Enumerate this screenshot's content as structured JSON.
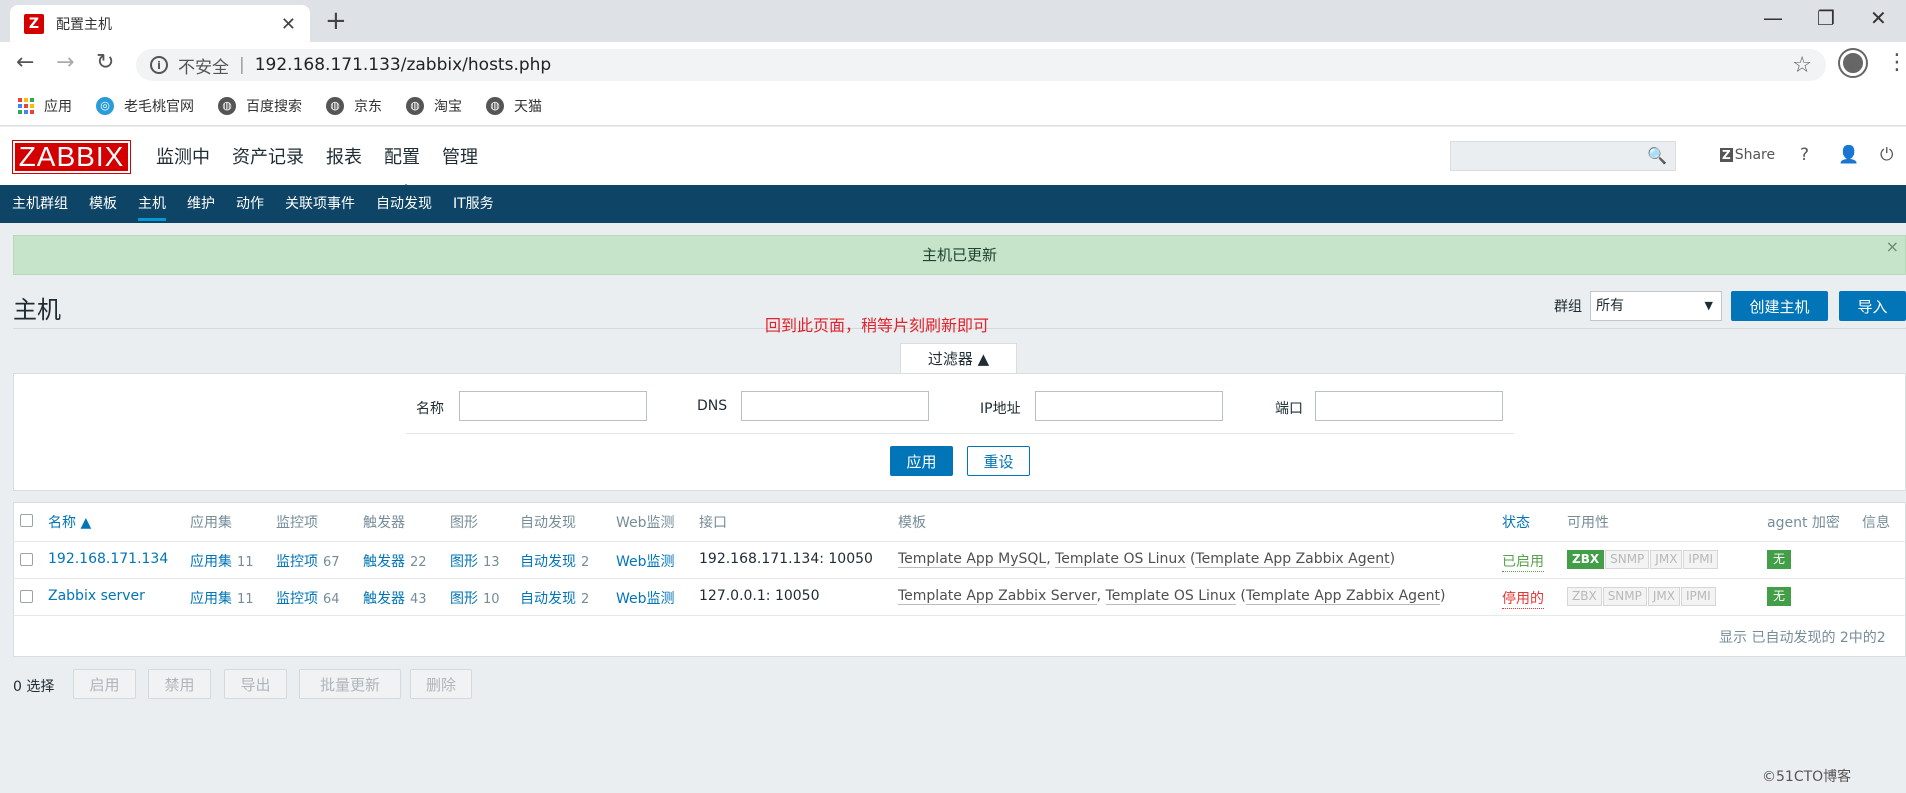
{
  "browser": {
    "tab_title": "配置主机",
    "security": "不安全",
    "url": "192.168.171.133/zabbix/hosts.php",
    "bookmarks": [
      "应用",
      "老毛桃官网",
      "百度搜索",
      "京东",
      "淘宝",
      "天猫"
    ]
  },
  "header": {
    "logo": "ZABBIX",
    "menu": [
      "监测中",
      "资产记录",
      "报表",
      "配置",
      "管理"
    ],
    "share": "Share",
    "help": "?"
  },
  "subnav": [
    "主机群组",
    "模板",
    "主机",
    "维护",
    "动作",
    "关联项事件",
    "自动发现",
    "IT服务"
  ],
  "message": "主机已更新",
  "page": {
    "title": "主机",
    "group_label": "群组",
    "group_value": "所有",
    "create_btn": "创建主机",
    "import_btn": "导入",
    "annotation": "回到此页面，稍等片刻刷新即可"
  },
  "filter": {
    "tab": "过滤器 ▲",
    "name_label": "名称",
    "dns_label": "DNS",
    "ip_label": "IP地址",
    "port_label": "端口",
    "apply": "应用",
    "reset": "重设"
  },
  "table": {
    "headers": [
      "名称 ▲",
      "应用集",
      "监控项",
      "触发器",
      "图形",
      "自动发现",
      "Web监测",
      "接口",
      "模板",
      "状态",
      "可用性",
      "agent 加密",
      "信息"
    ],
    "rows": [
      {
        "name": "192.168.171.134",
        "apps": "应用集",
        "apps_n": "11",
        "items": "监控项",
        "items_n": "67",
        "triggers": "触发器",
        "triggers_n": "22",
        "graphs": "图形",
        "graphs_n": "13",
        "discovery": "自动发现",
        "discovery_n": "2",
        "web": "Web监测",
        "interface": "192.168.171.134: 10050",
        "t1": "Template App MySQL",
        "t2": "Template OS Linux",
        "t3": "Template App Zabbix Agent",
        "status": "已启用",
        "encryption": "无"
      },
      {
        "name": "Zabbix server",
        "apps": "应用集",
        "apps_n": "11",
        "items": "监控项",
        "items_n": "64",
        "triggers": "触发器",
        "triggers_n": "43",
        "graphs": "图形",
        "graphs_n": "10",
        "discovery": "自动发现",
        "discovery_n": "2",
        "web": "Web监测",
        "interface": "127.0.0.1: 10050",
        "t1": "Template App Zabbix Server",
        "t2": "Template OS Linux",
        "t3": "Template App Zabbix Agent",
        "status": "停用的",
        "encryption": "无"
      }
    ],
    "availability": [
      "ZBX",
      "SNMP",
      "JMX",
      "IPMI"
    ],
    "footer": "显示 已自动发现的 2中的2"
  },
  "actions": {
    "selected": "0 选择",
    "buttons": [
      "启用",
      "禁用",
      "导出",
      "批量更新",
      "删除"
    ]
  },
  "watermark": "©51CTO博客"
}
